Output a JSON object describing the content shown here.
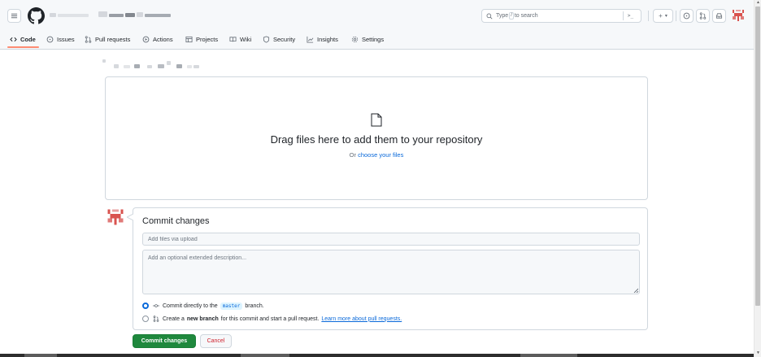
{
  "colors": {
    "accent": "#0969da",
    "primary_button": "#1f883d",
    "danger": "#cf222e",
    "nav_underline": "#fd8c73",
    "border": "#d0d7de"
  },
  "header": {
    "search": {
      "placeholder_prefix": "Type",
      "placeholder_key": "/",
      "placeholder_suffix": "to search",
      "command_palette": ">_"
    },
    "actions": {
      "new_label": "+",
      "new_caret": "▾"
    }
  },
  "repo_nav": {
    "tabs": [
      {
        "label": "Code",
        "icon": "code-icon"
      },
      {
        "label": "Issues",
        "icon": "issue-icon"
      },
      {
        "label": "Pull requests",
        "icon": "pull-request-icon"
      },
      {
        "label": "Actions",
        "icon": "play-icon"
      },
      {
        "label": "Projects",
        "icon": "table-icon"
      },
      {
        "label": "Wiki",
        "icon": "book-icon"
      },
      {
        "label": "Security",
        "icon": "shield-icon"
      },
      {
        "label": "Insights",
        "icon": "graph-icon"
      },
      {
        "label": "Settings",
        "icon": "gear-icon"
      }
    ]
  },
  "dropzone": {
    "title": "Drag files here to add them to your repository",
    "subtitle_prefix": "Or",
    "subtitle_link": "choose your files"
  },
  "commit": {
    "title": "Commit changes",
    "summary_placeholder": "Add files via upload",
    "description_placeholder": "Add an optional extended description...",
    "option_direct_prefix": "Commit directly to the",
    "option_direct_branch": "master",
    "option_direct_suffix": "branch.",
    "option_new_prefix": "Create a",
    "option_new_bold": "new branch",
    "option_new_suffix": "for this commit and start a pull request.",
    "option_new_link": "Learn more about pull requests.",
    "commit_button": "Commit changes",
    "cancel_button": "Cancel"
  }
}
